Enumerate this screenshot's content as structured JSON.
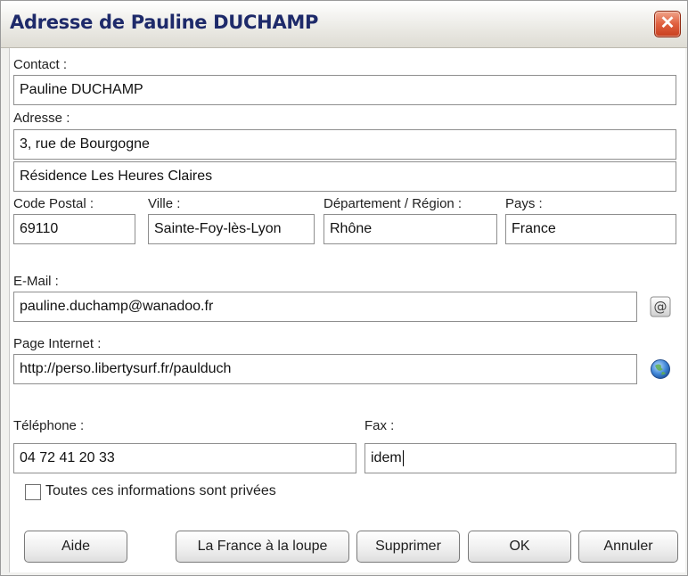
{
  "window": {
    "title": "Adresse de Pauline DUCHAMP",
    "close_glyph": "✕"
  },
  "form": {
    "contact": {
      "label": "Contact :",
      "value": "Pauline DUCHAMP"
    },
    "adresse": {
      "label": "Adresse :",
      "line1": "3,  rue de Bourgogne",
      "line2": "Résidence Les Heures Claires"
    },
    "code_postal": {
      "label": "Code Postal :",
      "value": "69110"
    },
    "ville": {
      "label": "Ville :",
      "value": "Sainte-Foy-lès-Lyon"
    },
    "departement": {
      "label": "Département / Région :",
      "value": "Rhône"
    },
    "pays": {
      "label": "Pays :",
      "value": "France"
    },
    "email": {
      "label": "E-Mail :",
      "value": "pauline.duchamp@wanadoo.fr",
      "icon": "at-sign-icon",
      "icon_glyph": "@"
    },
    "page_internet": {
      "label": "Page Internet :",
      "value": "http://perso.libertysurf.fr/paulduch",
      "icon": "globe-icon"
    },
    "telephone": {
      "label": "Téléphone :",
      "value": "04 72 41 20 33"
    },
    "fax": {
      "label": "Fax :",
      "value": "idem"
    },
    "prive": {
      "label": "Toutes ces informations sont privées",
      "checked": false
    }
  },
  "buttons": {
    "aide": "Aide",
    "france_loupe": "La France à la loupe",
    "supprimer": "Supprimer",
    "ok": "OK",
    "annuler": "Annuler"
  },
  "colors": {
    "title_text": "#1e2a6a",
    "close_button": "#d9532f"
  }
}
